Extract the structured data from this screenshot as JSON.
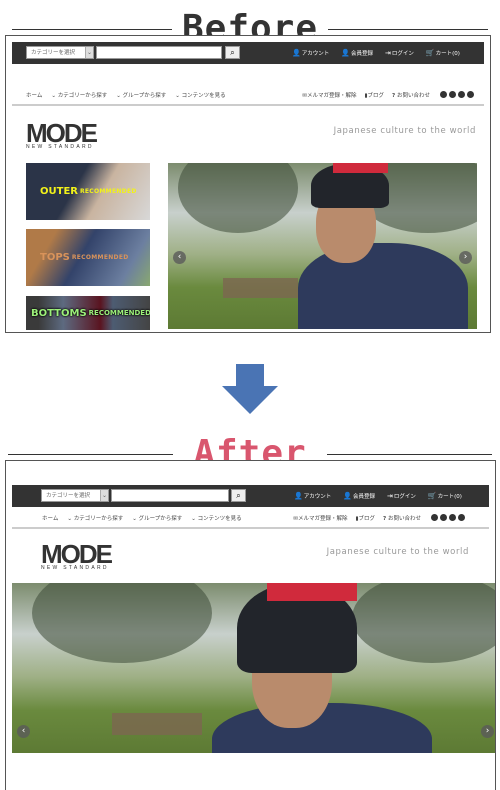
{
  "before": {
    "title": "Before",
    "color": "#333333"
  },
  "after": {
    "title": "After",
    "color": "#d9566e"
  },
  "site": {
    "category_select": "カテゴリーを選択",
    "search_placeholder": "",
    "account": "アカウント",
    "register": "会員登録",
    "login": "ログイン",
    "cart": "カート(0)",
    "nav": [
      "ホーム",
      "カテゴリーから探す",
      "グループから探す",
      "コンテンツを見る"
    ],
    "nav_right": [
      "メルマガ登録・解除",
      "ブログ",
      "お問い合わせ"
    ],
    "social_icons": [
      "twitter-icon",
      "facebook-icon",
      "google-plus-icon",
      "pinterest-icon"
    ],
    "logo": "MODE",
    "logo_sub": "NEW STANDARD",
    "tagline": "Japanese culture to the world",
    "banners": [
      {
        "name": "OUTER",
        "sub": "RECOMMENDED",
        "color": "#f2f21a"
      },
      {
        "name": "TOPS",
        "sub": "RECOMMENDED",
        "color": "#d9935a"
      },
      {
        "name": "BOTTOMS",
        "sub": "RECOMMENDED",
        "color": "#9cf07a"
      }
    ]
  },
  "arrow_color": "#4a74b4"
}
